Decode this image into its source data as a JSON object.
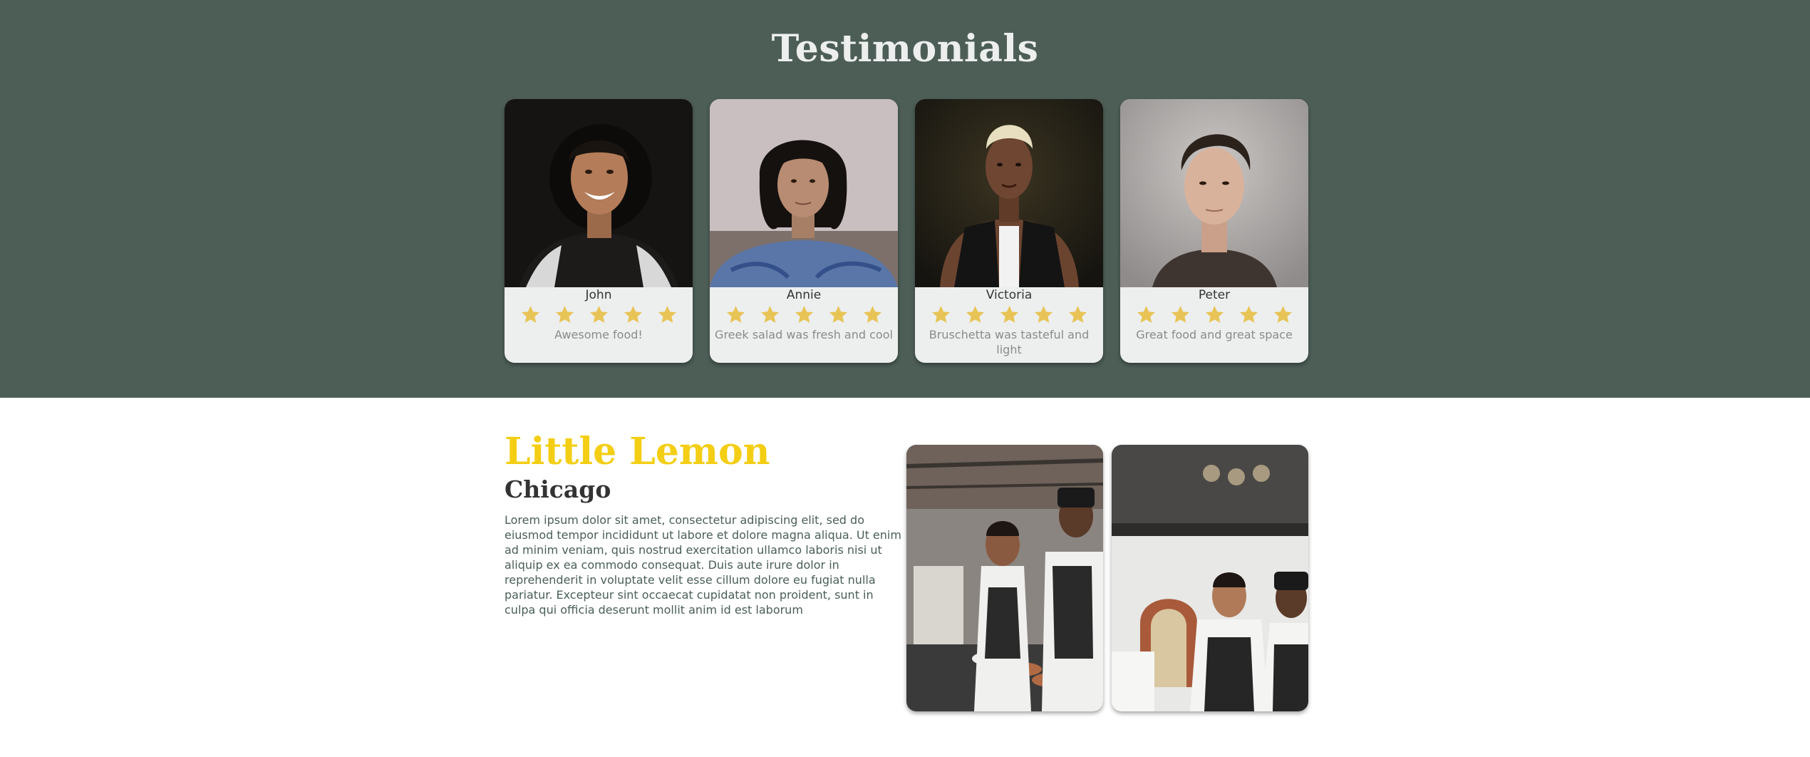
{
  "testimonials": {
    "title": "Testimonials",
    "rating_color": "#e8c457",
    "cards": [
      {
        "name": "John",
        "rating": 5,
        "review": "Awesome food!"
      },
      {
        "name": "Annie",
        "rating": 5,
        "review": "Greek salad was fresh and cool"
      },
      {
        "name": "Victoria",
        "rating": 5,
        "review": "Bruschetta was tasteful and light"
      },
      {
        "name": "Peter",
        "rating": 5,
        "review": "Great food and great space"
      }
    ]
  },
  "about": {
    "title": "Little Lemon",
    "subtitle": "Chicago",
    "body": "Lorem ipsum dolor sit amet, consectetur adipiscing elit, sed do eiusmod tempor incididunt ut labore et dolore magna aliqua. Ut enim ad minim veniam, quis nostrud exercitation ullamco laboris nisi ut aliquip ex ea commodo consequat. Duis aute irure dolor in reprehenderit in voluptate velit esse cillum dolore eu fugiat nulla pariatur. Excepteur sint occaecat cupidatat non proident, sunt in culpa qui officia deserunt mollit anim id est laborum"
  },
  "colors": {
    "primary_green": "#495e57",
    "primary_yellow": "#f4ce14",
    "highlight_light": "#edefee",
    "highlight_dark": "#333333"
  }
}
